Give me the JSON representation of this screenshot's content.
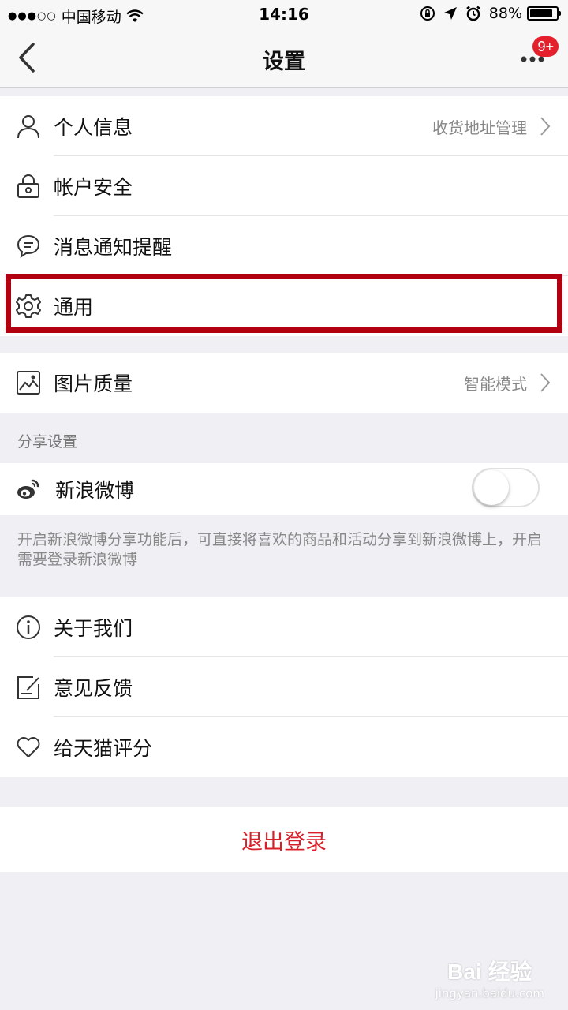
{
  "status_bar": {
    "signal": "●●●○○",
    "carrier": "中国移动",
    "time": "14:16",
    "battery_percent": "88%",
    "battery_level": 0.88
  },
  "nav": {
    "title": "设置",
    "badge": "9+"
  },
  "group1": [
    {
      "label": "个人信息",
      "value": "收货地址管理",
      "icon": "person-icon"
    },
    {
      "label": "帐户安全",
      "value": "",
      "icon": "lock-icon"
    },
    {
      "label": "消息通知提醒",
      "value": "",
      "icon": "message-icon"
    },
    {
      "label": "通用",
      "value": "",
      "icon": "gear-icon"
    }
  ],
  "image_quality": {
    "label": "图片质量",
    "value": "智能模式",
    "icon": "image-icon"
  },
  "share_section": {
    "header": "分享设置",
    "weibo_label": "新浪微博",
    "weibo_enabled": false,
    "note": "开启新浪微博分享功能后，可直接将喜欢的商品和活动分享到新浪微博上，开启需要登录新浪微博"
  },
  "group3": [
    {
      "label": "关于我们",
      "icon": "info-icon"
    },
    {
      "label": "意见反馈",
      "icon": "feedback-icon"
    },
    {
      "label": "给天猫评分",
      "icon": "heart-icon"
    }
  ],
  "logout_label": "退出登录",
  "watermark": {
    "main": "Bai 经验",
    "sub": "jingyan.baidu.com"
  },
  "colors": {
    "accent_red": "#d8202a",
    "highlight_border": "#b30010",
    "badge_red": "#e4202c",
    "background": "#efeff4"
  }
}
